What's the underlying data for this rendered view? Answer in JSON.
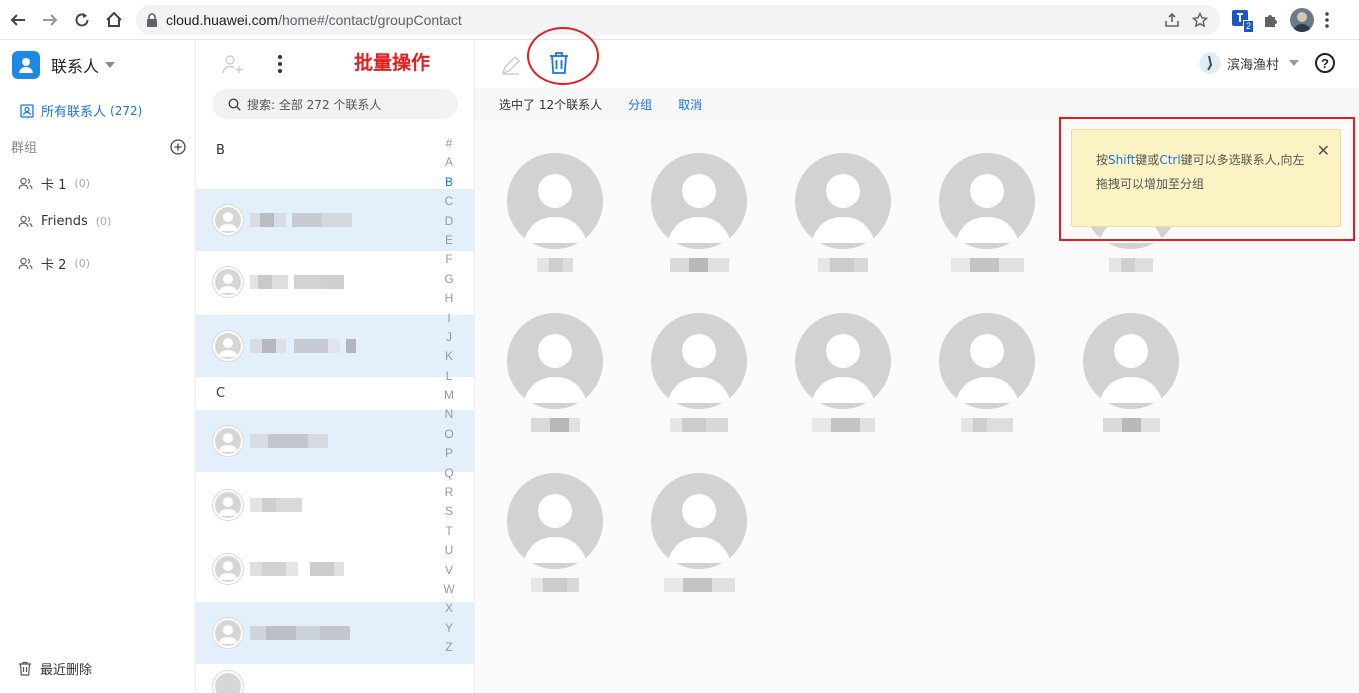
{
  "browser": {
    "url_host": "cloud.huawei.com",
    "url_path": "/home#/contact/groupContact",
    "extension_badge": "2"
  },
  "sidebar": {
    "title": "联系人",
    "all_contacts": "所有联系人",
    "all_count": "(272)",
    "groups_label": "群组",
    "groups": [
      {
        "name": "卡 1",
        "count": "(0)"
      },
      {
        "name": "Friends",
        "count": "(0)"
      },
      {
        "name": "卡 2",
        "count": "(0)"
      }
    ],
    "recent_deleted": "最近删除"
  },
  "list": {
    "batch_label": "批量操作",
    "search_placeholder": "搜索: 全部 272 个联系人",
    "sections": [
      "B",
      "C"
    ],
    "alphabet": [
      "#",
      "A",
      "B",
      "C",
      "D",
      "E",
      "F",
      "G",
      "H",
      "I",
      "J",
      "K",
      "L",
      "M",
      "N",
      "O",
      "P",
      "Q",
      "R",
      "S",
      "T",
      "U",
      "V",
      "W",
      "X",
      "Y",
      "Z"
    ],
    "active_letter": "B"
  },
  "main": {
    "account_name": "滨海渔村",
    "selection_text": "选中了 12个联系人",
    "group_link": "分组",
    "cancel_link": "取消",
    "tip": {
      "prefix": "按",
      "shift": "Shift",
      "mid": "键或",
      "ctrl": "Ctrl",
      "suffix": "键可以多选联系人,向左拖拽可以增加至分组"
    }
  },
  "colors": {
    "accent": "#1a73e8",
    "annotation": "#e02020",
    "selected_row": "#e4effc",
    "tip_bg": "#fcf3c4"
  }
}
